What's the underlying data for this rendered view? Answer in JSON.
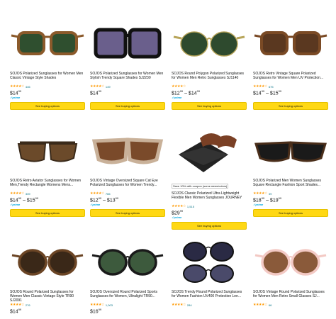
{
  "button_label": "See buying options",
  "products": [
    {
      "title": "SOJOS Polarized Sunglasses for Women Men Classic Vintage Style Shades",
      "stars": "★★★★☆",
      "reviews": "446",
      "price": "$14",
      "price_cents": "99",
      "price_high": "",
      "price_high_cents": "",
      "prime": "✓prime",
      "badge": "",
      "frame": "#8b5a2b",
      "lens": "#2f4f2f",
      "shape": "square"
    },
    {
      "title": "SOJOS Polarized Sunglasses for Women Men Stylish Trendy Square Shades SJ2230",
      "stars": "★★★★☆",
      "reviews": "149",
      "price": "$14",
      "price_cents": "99",
      "price_high": "",
      "price_high_cents": "",
      "prime": "",
      "badge": "",
      "frame": "#111111",
      "lens": "#6a5f8c",
      "shape": "big"
    },
    {
      "title": "SOJOS Round Polygon Polarized Sunglasses for Women Men Retro Sunglasses SJ1140",
      "stars": "★★★★☆",
      "reviews": "",
      "price": "$12",
      "price_cents": "99",
      "price_high": "$14",
      "price_high_cents": "99",
      "prime": "✓prime",
      "badge": "",
      "frame": "#b8a55a",
      "lens": "#2e4a2e",
      "shape": "round"
    },
    {
      "title": "SOJOS Retro Vintage Square Polarized Sunglasses for Women Men UV Protection...",
      "stars": "★★★★☆",
      "reviews": "675",
      "price": "$14",
      "price_cents": "99",
      "price_high": "$15",
      "price_high_cents": "99",
      "prime": "",
      "badge": "",
      "frame": "#7a4a25",
      "lens": "#5a3820",
      "shape": "square"
    },
    {
      "title": "SOJOS Retro Aviator Sunglasses for Women Men,Trendy Rectangle Womens Mens...",
      "stars": "★★★★☆",
      "reviews": "339",
      "price": "$14",
      "price_cents": "99",
      "price_high": "$15",
      "price_high_cents": "99",
      "prime": "✓prime",
      "badge": "",
      "frame": "#3a2a1a",
      "lens": "#6b4a2a",
      "shape": "aviator"
    },
    {
      "title": "SOJOS Vintage Oversized Square Cat Eye Polarized Sunglasses for Women Trendy...",
      "stars": "★★★★☆",
      "reviews": "766",
      "price": "$12",
      "price_cents": "99",
      "price_high": "$13",
      "price_high_cents": "99",
      "prime": "✓prime",
      "badge": "",
      "frame": "#c9b199",
      "lens": "#7a4a2a",
      "shape": "cat"
    },
    {
      "title": "SOJOS Classic Polarized Ultra Lightweight Flexible Men Women Sunglasses JOURNEY",
      "stars": "★★★★☆",
      "reviews": "1,515",
      "price": "$29",
      "price_cents": "99",
      "price_high": "",
      "price_high_cents": "",
      "prime": "✓prime",
      "badge": "Save 10% with coupon (some sizes/colors)",
      "frame": "#6b3a1e",
      "lens": "#7a4025",
      "shape": "case"
    },
    {
      "title": "SOJOS Polarized Men Women Sunglasses Square Rectangle Fashion Sport Shades...",
      "stars": "★★★★☆",
      "reviews": "39",
      "price": "$18",
      "price_cents": "99",
      "price_high": "$19",
      "price_high_cents": "99",
      "prime": "✓prime",
      "badge": "",
      "frame": "#4a2e1a",
      "lens": "#1a1a1a",
      "shape": "wide"
    },
    {
      "title": "SOJOS Round Polarized Sunglasses for Women Men Classic Vintage Style TR90 SJ2091",
      "stars": "★★★★☆",
      "reviews": "276",
      "price": "$14",
      "price_cents": "99",
      "price_high": "",
      "price_high_cents": "",
      "prime": "",
      "badge": "",
      "frame": "#6b4525",
      "lens": "#3a2818",
      "shape": "round2"
    },
    {
      "title": "SOJOS Oversized Round Polarized Sports Sunglasses for Women, Ultralight TR90...",
      "stars": "★★★★☆",
      "reviews": "1,003",
      "price": "$16",
      "price_cents": "99",
      "price_high": "",
      "price_high_cents": "",
      "prime": "",
      "badge": "",
      "frame": "#1a1a1a",
      "lens": "#3d5a3d",
      "shape": "round2"
    },
    {
      "title": "SOJOS Trendy Round Polarized Sunglasses for Women Fashion UV400 Protection Len...",
      "stars": "★★★★☆",
      "reviews": "284",
      "price": "",
      "price_cents": "",
      "price_high": "",
      "price_high_cents": "",
      "prime": "",
      "badge": "",
      "frame": "#111111",
      "lens": "#2a2a44",
      "shape": "double"
    },
    {
      "title": "SOJOS Vintage Round Polarized Sunglasses for Women Men Retro Small Glasses SJ...",
      "stars": "★★★★☆",
      "reviews": "66",
      "price": "",
      "price_cents": "",
      "price_high": "",
      "price_high_cents": "",
      "prime": "",
      "badge": "",
      "frame": "#f3c9c4",
      "lens": "#8a5a3a",
      "shape": "round2"
    }
  ]
}
